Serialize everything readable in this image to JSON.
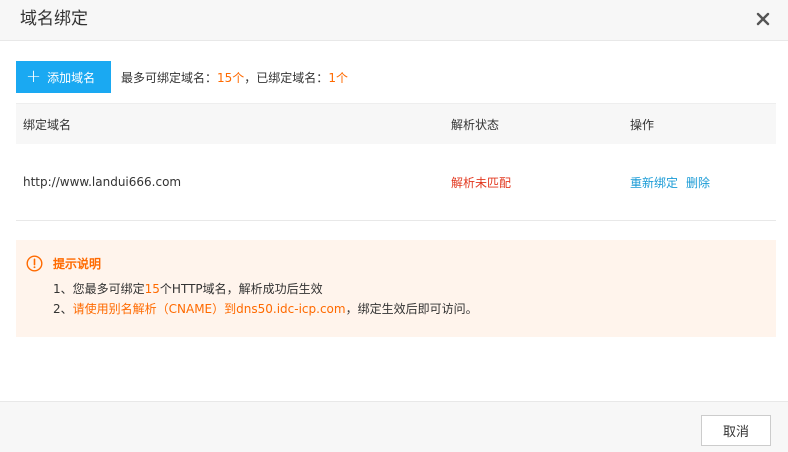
{
  "dialog": {
    "title": "域名绑定",
    "close_icon": "close-icon"
  },
  "toolbar": {
    "add_button_label": "添加域名",
    "add_icon": "plus-icon",
    "limit_prefix": "最多可绑定域名：",
    "limit_value": "15个",
    "bound_prefix": "，已绑定域名：",
    "bound_value": "1个"
  },
  "table": {
    "columns": [
      "绑定域名",
      "解析状态",
      "操作"
    ],
    "rows": [
      {
        "domain": "http://www.landui666.com",
        "status": "解析未匹配",
        "actions": [
          "重新绑定",
          "删除"
        ]
      }
    ]
  },
  "notice": {
    "icon": "warning-circle-icon",
    "title": "提示说明",
    "line1_prefix": "1、您最多可绑定",
    "line1_value": "15",
    "line1_suffix": "个HTTP域名，解析成功后生效",
    "line2_prefix": "2、",
    "line2_highlight": "请使用别名解析（CNAME）到dns50.idc-icp.com",
    "line2_suffix": "，绑定生效后即可访问。"
  },
  "footer": {
    "cancel_label": "取消"
  },
  "colors": {
    "primary": "#1aa9f2",
    "highlight": "#ff6a00",
    "error": "#e2381f",
    "link": "#1a9bd6",
    "notice_bg": "#fff4ec"
  }
}
